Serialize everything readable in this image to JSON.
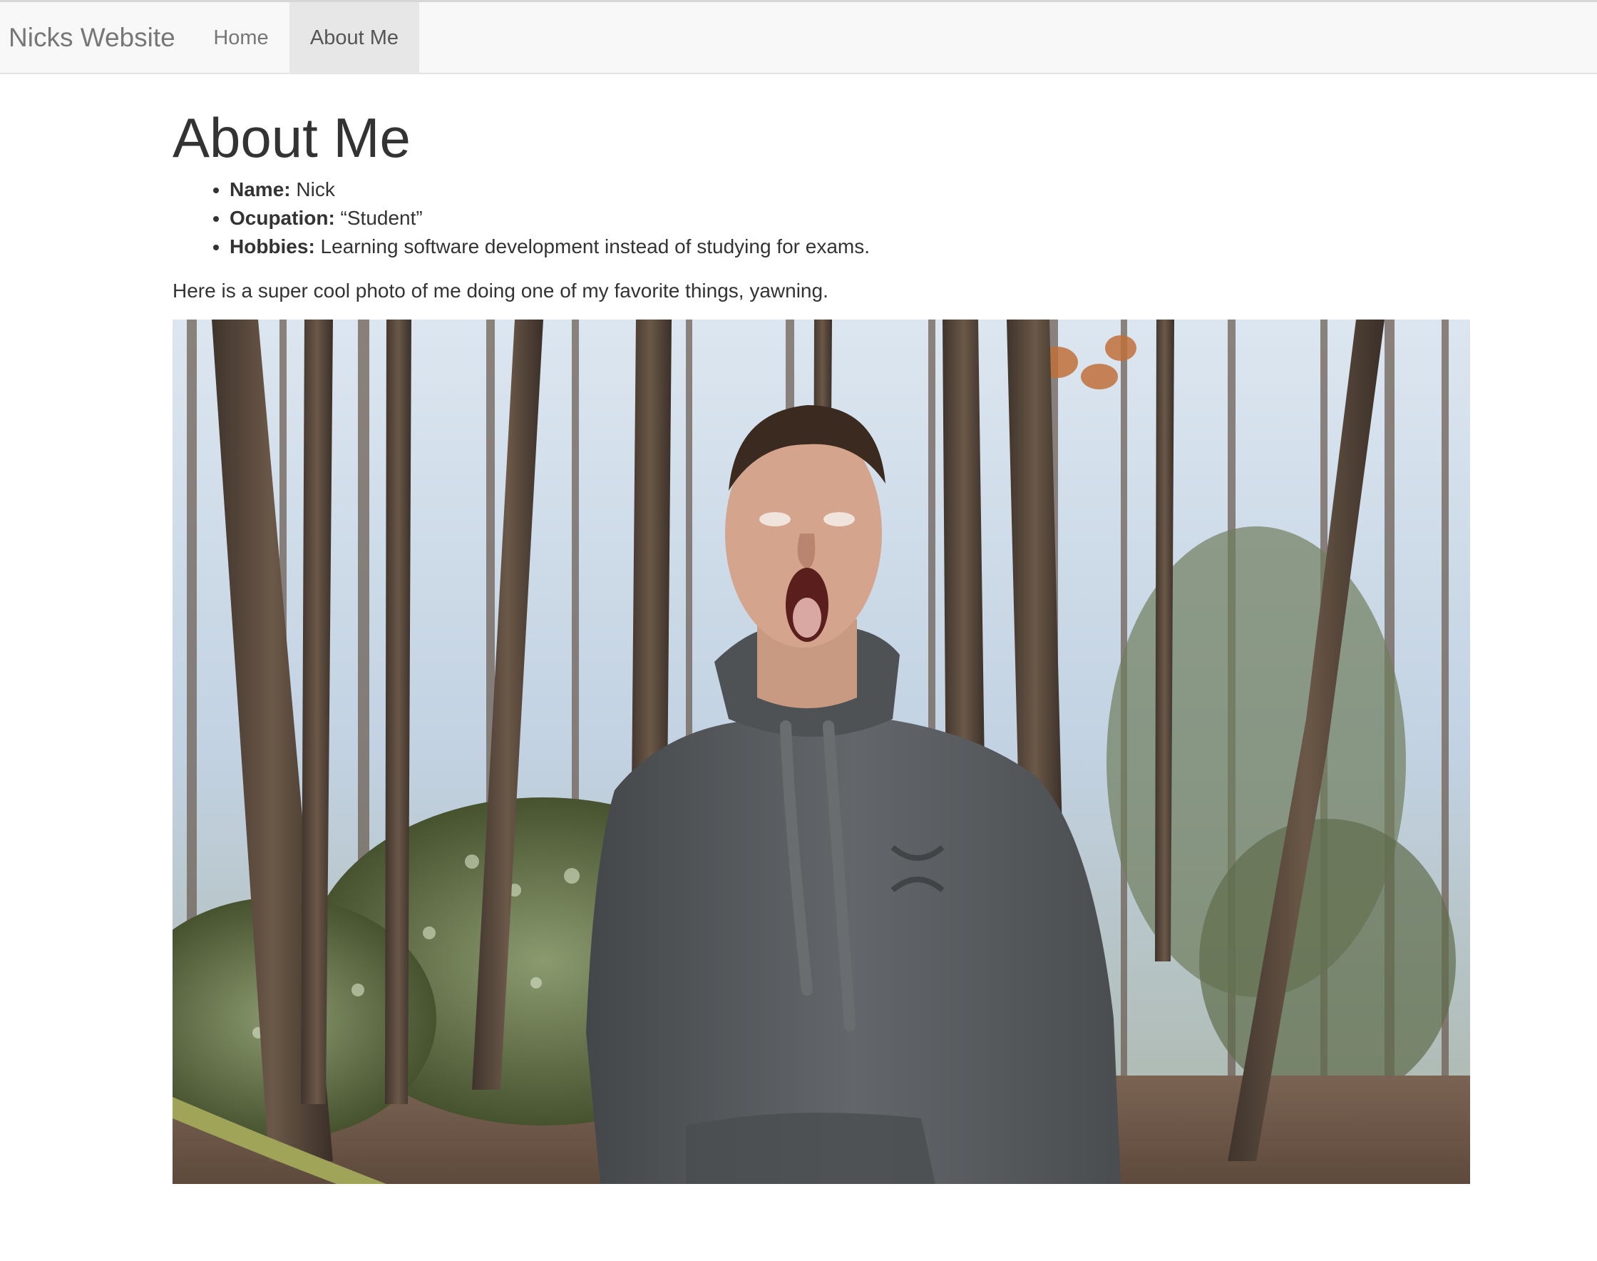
{
  "navbar": {
    "brand": "Nicks Website",
    "items": [
      {
        "label": "Home",
        "active": false
      },
      {
        "label": "About Me",
        "active": true
      }
    ]
  },
  "page": {
    "title": "About Me",
    "facts": [
      {
        "label": "Name:",
        "value": " Nick"
      },
      {
        "label": "Ocupation:",
        "value": " “Student”"
      },
      {
        "label": "Hobbies:",
        "value": " Learning software development instead of studying for exams."
      }
    ],
    "caption": "Here is a super cool photo of me doing one of my favorite things, yawning."
  },
  "photo": {
    "subject": "person-yawning-in-forest",
    "colors": {
      "sky": "#c9d8e8",
      "trunk": "#5a4a3e",
      "foliage": "#5d6b45",
      "ground": "#6b5444",
      "hoodie": "#56595c",
      "skin": "#d4a48c"
    }
  }
}
